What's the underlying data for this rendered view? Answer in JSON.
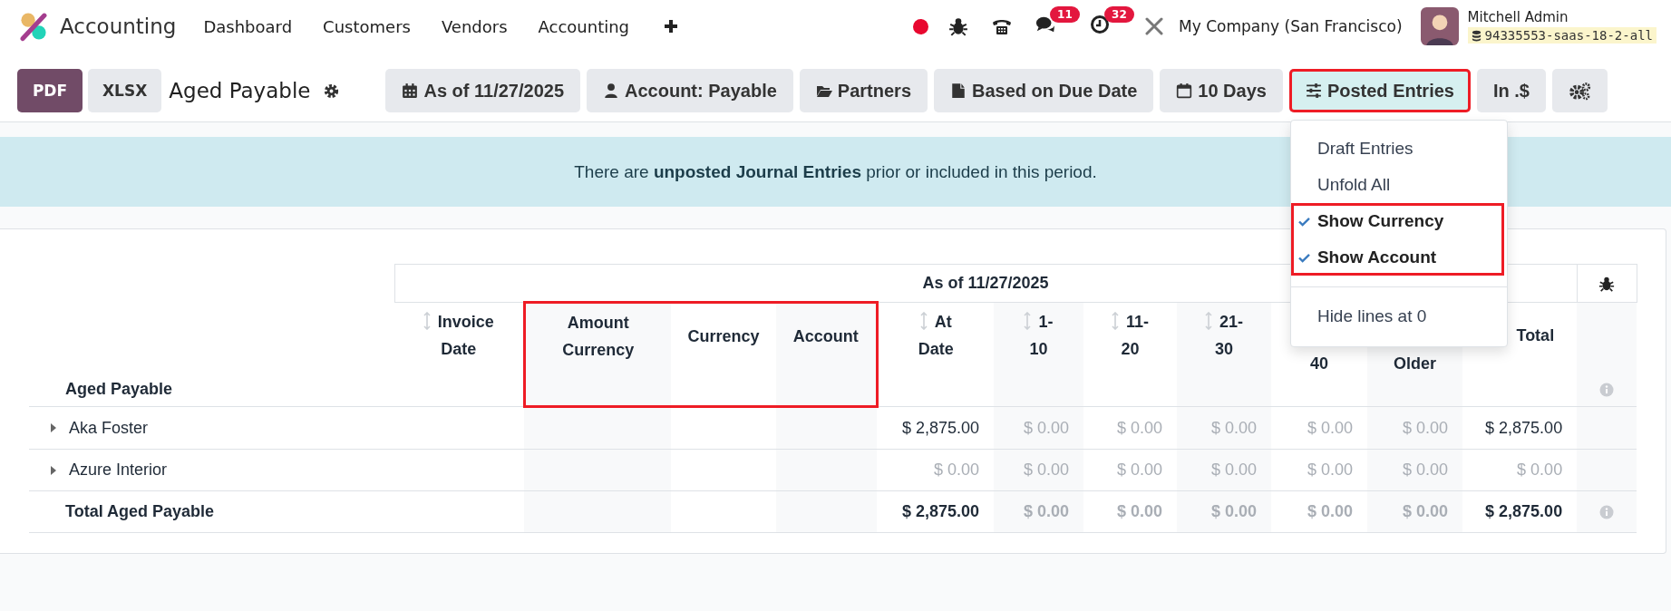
{
  "navbar": {
    "app_name": "Accounting",
    "menu": [
      {
        "label": "Dashboard"
      },
      {
        "label": "Customers"
      },
      {
        "label": "Vendors"
      },
      {
        "label": "Accounting"
      }
    ],
    "chat_badge": "11",
    "activity_badge": "32",
    "company": "My Company (San Francisco)",
    "user_name": "Mitchell Admin",
    "database": "94335553-saas-18-2-all"
  },
  "toolbar": {
    "buttons": [
      {
        "label": "PDF",
        "kind": "primary"
      },
      {
        "label": "XLSX",
        "kind": "secondary"
      }
    ],
    "title": "Aged Payable",
    "filters": [
      {
        "label": "As of 11/27/2025",
        "open": false,
        "highlighted": false
      },
      {
        "label": "Account: Payable",
        "open": false,
        "highlighted": false
      },
      {
        "label": "Partners",
        "open": false,
        "highlighted": false
      },
      {
        "label": "Based on Due Date",
        "open": false,
        "highlighted": false
      },
      {
        "label": "10 Days",
        "open": false,
        "highlighted": false
      },
      {
        "label": "Posted Entries",
        "open": true,
        "highlighted": true
      },
      {
        "label": "In .$",
        "open": false,
        "highlighted": false
      },
      {
        "open": false,
        "highlighted": false
      }
    ]
  },
  "alert": {
    "message": "There are **unposted Journal Entries** prior or included in this period."
  },
  "dropdown": {
    "groups": [
      {
        "highlighted": false,
        "divider_before": false,
        "items": [
          {
            "label": "Draft Entries",
            "checked": false
          },
          {
            "label": "Unfold All",
            "checked": false
          }
        ]
      },
      {
        "highlighted": true,
        "divider_before": false,
        "items": [
          {
            "label": "Show Currency",
            "checked": true
          },
          {
            "label": "Show Account",
            "checked": true
          }
        ]
      },
      {
        "highlighted": false,
        "divider_before": true,
        "items": [
          {
            "label": "Hide lines at 0",
            "checked": false
          }
        ]
      }
    ]
  },
  "report": {
    "period_header": "As of 11/27/2025",
    "title": "Aged Payable",
    "columns": [
      {
        "lines": [
          "Invoice",
          "Date"
        ],
        "kind": "text",
        "sortable": true,
        "highlighted": false,
        "cut_top": false
      },
      {
        "lines": [
          "Amount",
          "Currency"
        ],
        "kind": "text",
        "sortable": false,
        "highlighted": true,
        "cut_top": false
      },
      {
        "lines": [
          "Currency"
        ],
        "kind": "text",
        "sortable": false,
        "highlighted": true,
        "cut_top": false
      },
      {
        "lines": [
          "Account"
        ],
        "kind": "text",
        "sortable": false,
        "highlighted": true,
        "cut_top": false
      },
      {
        "lines": [
          "At",
          "Date"
        ],
        "kind": "amount",
        "sortable": true,
        "highlighted": false,
        "cut_top": false
      },
      {
        "lines": [
          "1-",
          "10"
        ],
        "kind": "amount",
        "sortable": true,
        "highlighted": false,
        "cut_top": false
      },
      {
        "lines": [
          "11-",
          "20"
        ],
        "kind": "amount",
        "sortable": true,
        "highlighted": false,
        "cut_top": false
      },
      {
        "lines": [
          "21-",
          "30"
        ],
        "kind": "amount",
        "sortable": true,
        "highlighted": false,
        "cut_top": false
      },
      {
        "lines": [
          "40"
        ],
        "kind": "amount",
        "sortable": false,
        "highlighted": false,
        "cut_top": true
      },
      {
        "lines": [
          "Older"
        ],
        "kind": "amount",
        "sortable": false,
        "highlighted": false,
        "cut_top": true
      },
      {
        "lines": [
          "Total"
        ],
        "kind": "amount",
        "sortable": false,
        "highlighted": false,
        "cut_top": false
      }
    ],
    "rows": [
      {
        "label": "Aka Foster",
        "kind": "partner",
        "amounts": [
          {
            "text": "$ 2,875.00",
            "zero": false
          },
          {
            "text": "$ 0.00",
            "zero": true
          },
          {
            "text": "$ 0.00",
            "zero": true
          },
          {
            "text": "$ 0.00",
            "zero": true
          },
          {
            "text": "$ 0.00",
            "zero": true
          },
          {
            "text": "$ 0.00",
            "zero": true
          },
          {
            "text": "$ 2,875.00",
            "zero": false
          }
        ]
      },
      {
        "label": "Azure Interior",
        "kind": "partner",
        "amounts": [
          {
            "text": "$ 0.00",
            "zero": true
          },
          {
            "text": "$ 0.00",
            "zero": true
          },
          {
            "text": "$ 0.00",
            "zero": true
          },
          {
            "text": "$ 0.00",
            "zero": true
          },
          {
            "text": "$ 0.00",
            "zero": true
          },
          {
            "text": "$ 0.00",
            "zero": true
          },
          {
            "text": "$ 0.00",
            "zero": true
          }
        ]
      },
      {
        "label": "Total Aged Payable",
        "kind": "total",
        "amounts": [
          {
            "text": "$ 2,875.00",
            "zero": false
          },
          {
            "text": "$ 0.00",
            "zero": true
          },
          {
            "text": "$ 0.00",
            "zero": true
          },
          {
            "text": "$ 0.00",
            "zero": true
          },
          {
            "text": "$ 0.00",
            "zero": true
          },
          {
            "text": "$ 0.00",
            "zero": true
          },
          {
            "text": "$ 2,875.00",
            "zero": false
          }
        ]
      }
    ]
  }
}
